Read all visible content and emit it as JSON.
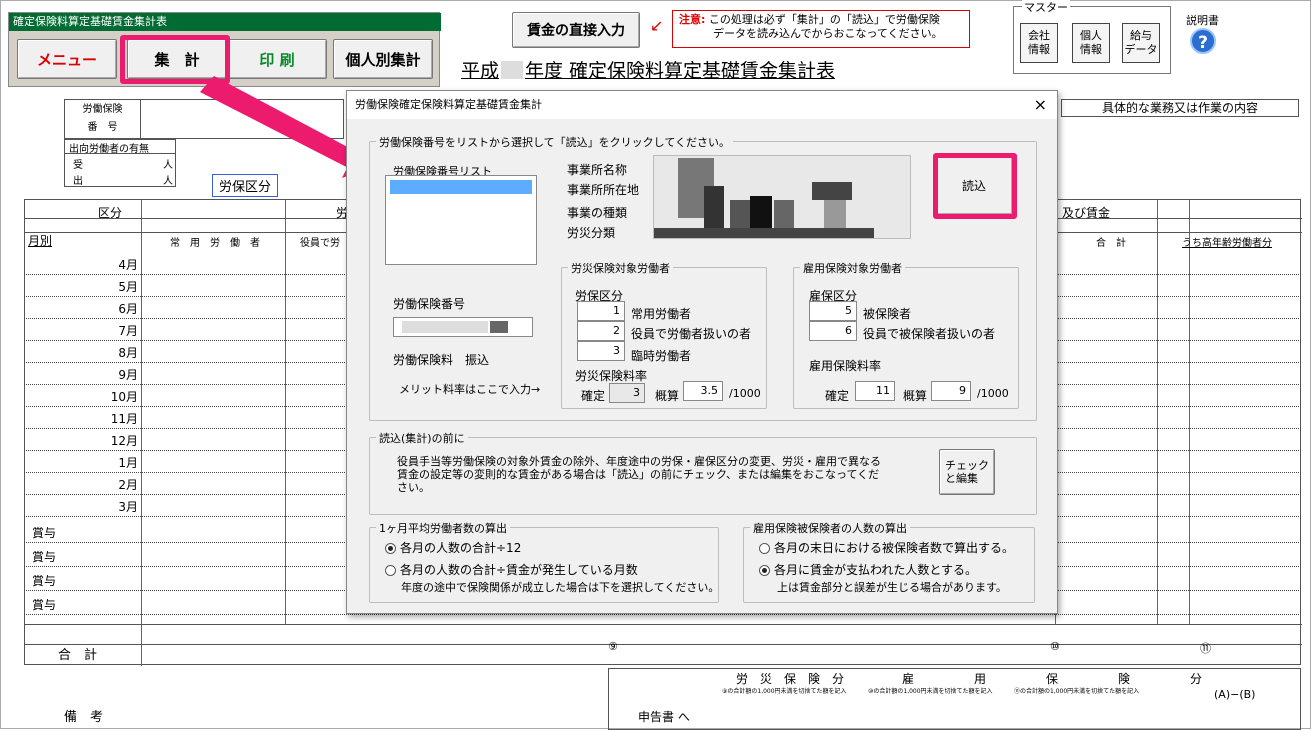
{
  "header": {
    "window_title": "確定保険料算定基礎賃金集計表",
    "menu_label": "メニュー",
    "total_label": "集　計",
    "print_label": "印 刷",
    "individual_label": "個人別集計",
    "direct_input_label": "賃金の直接入力",
    "note_prefix": "注意:",
    "note_line1": "この処理は必ず「集計」の「読込」で労働保険",
    "note_line2": "データを読み込んでからおこなってください。",
    "title_prefix": "平成",
    "title_suffix": "年度 確定保険料算定基礎賃金集計表"
  },
  "master": {
    "legend": "マスター",
    "company": "会社\n情報",
    "personal": "個人\n情報",
    "salary": "給与\nデータ",
    "manual_label": "説明書"
  },
  "sheet": {
    "insurance_no": "労働保険",
    "number": "番　号",
    "dispatch": "出向労働者の有無",
    "received": "受",
    "sent": "出",
    "person": "人",
    "callout": "労保区分",
    "division": "区分",
    "monthly": "月別",
    "regular_workers": "常　用　労　働　者",
    "officer": "役員で労",
    "work_content": "具体的な業務又は作業の内容",
    "wage": "及び賃金",
    "total_col": "合　計",
    "elderly": "うち高年齢労働者分",
    "months": [
      "4月",
      "5月",
      "6月",
      "7月",
      "8月",
      "9月",
      "10月",
      "11月",
      "12月",
      "1月",
      "2月",
      "3月"
    ],
    "bonus": [
      "賞与",
      "賞与",
      "賞与",
      "賞与"
    ],
    "total_row": "合　計",
    "remarks": "備　考",
    "report_to": "申告書 へ",
    "circ9": "⑨",
    "circ10": "⑩",
    "circ11": "⑪",
    "accident_part": "労　災　保　険　分",
    "employment_part": "雇　　　　　用　　　　　保　　　　　険　　　　　分",
    "ab": "(A)−(B)",
    "round_note": "⑨の合計額の1,000円未満を切捨てた額を記入",
    "round_note2": "⑩の合計額の1,000円未満を切捨てた額を記入",
    "round_note3": "⑪の合計額の1,000円未満を切捨てた額を記入"
  },
  "dialog": {
    "title": "労働保険確定保険料算定基礎賃金集計",
    "close": "×",
    "select_legend": "労働保険番号をリストから選択して「読込」をクリックしてください。",
    "list_label": "労働保険番号リスト",
    "office_name": "事業所名称",
    "office_address": "事業所所在地",
    "business_type": "事業の種類",
    "accident_class": "労災分類",
    "read_button": "読込",
    "insurance_no_label": "労働保険番号",
    "premium_label": "労働保険料　振込",
    "merit_label": "メリット料率はここで入力→",
    "accident_legend": "労災保険対象労働者",
    "accident_div": "労保区分",
    "div1": "1",
    "div1_label": "常用労働者",
    "div2": "2",
    "div2_label": "役員で労働者扱いの者",
    "div3": "3",
    "div3_label": "臨時労働者",
    "accident_rate": "労災保険料率",
    "confirmed": "確定",
    "confirmed_rate": "3",
    "estimate": "概算",
    "estimate_rate": "3.5",
    "per_mille": "/1000",
    "employment_legend": "雇用保険対象労働者",
    "employment_div": "雇保区分",
    "div5": "5",
    "div5_label": "被保険者",
    "div6": "6",
    "div6_label": "役員で被保険者扱いの者",
    "employment_rate": "雇用保険料率",
    "emp_confirmed_rate": "11",
    "emp_estimate_rate": "9",
    "before_legend": "読込(集計)の前に",
    "before_text": "役員手当等労働保険の対象外賃金の除外、年度途中の労保・雇保区分の変更、労災・雇用で異なる賃金の設定等の変則的な賃金がある場合は「読込」の前にチェック、または編集をおこなってください。",
    "check_button": "チェック\nと編集",
    "avg_legend": "1ヶ月平均労働者数の算出",
    "avg_opt1": "各月の人数の合計÷12",
    "avg_opt2": "各月の人数の合計÷賃金が発生している月数",
    "avg_note": "年度の途中で保険関係が成立した場合は下を選択してください。",
    "emp_count_legend": "雇用保険被保険者の人数の算出",
    "emp_opt1": "各月の末日における被保険者数で算出する。",
    "emp_opt2": "各月に賃金が支払われた人数とする。",
    "emp_note": "上は賃金部分と誤差が生じる場合があります。"
  },
  "colors": {
    "highlight": "#ec1b6e",
    "header_green": "#006b32",
    "selection": "#3399ff"
  }
}
